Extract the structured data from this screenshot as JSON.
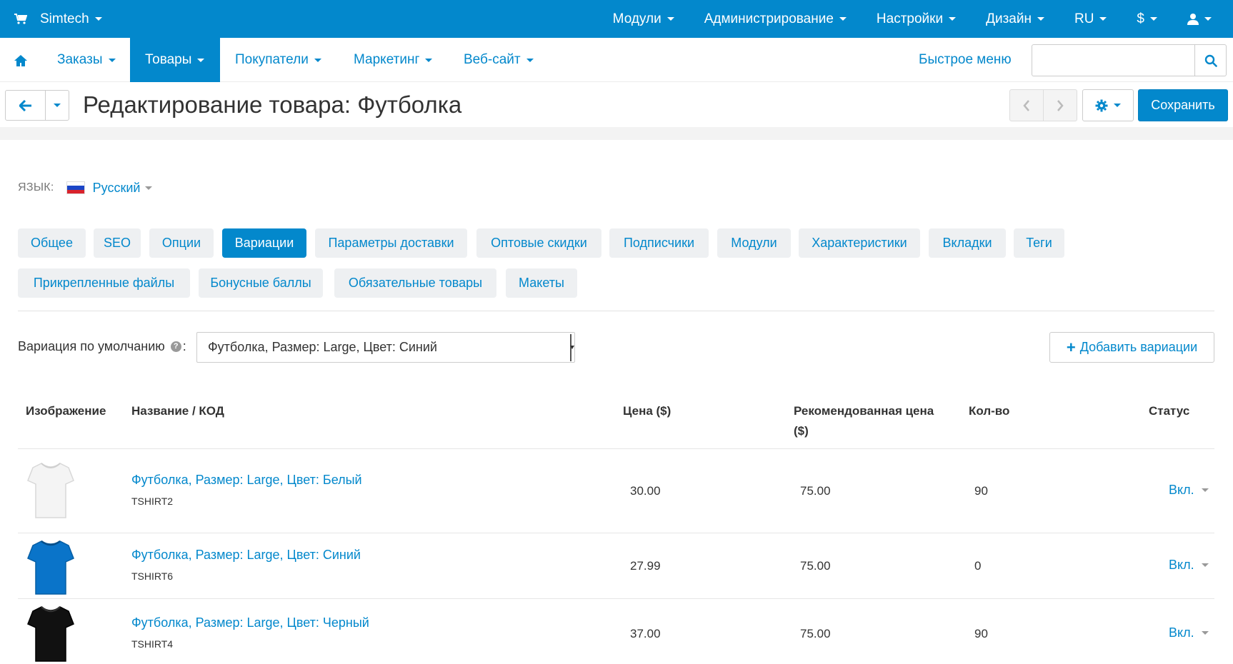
{
  "topbar": {
    "brand": "Simtech",
    "menu": [
      "Модули",
      "Администрирование",
      "Настройки",
      "Дизайн",
      "RU",
      "$"
    ]
  },
  "nav": {
    "tabs": [
      "Заказы",
      "Товары",
      "Покупатели",
      "Маркетинг",
      "Веб-сайт"
    ],
    "active_tab": "Товары",
    "quick_menu": "Быстрое меню",
    "search_placeholder": ""
  },
  "page": {
    "title": "Редактирование товара: Футболка",
    "save_label": "Сохранить"
  },
  "language": {
    "label": "ЯЗЫК:",
    "value": "Русский"
  },
  "section_tabs": {
    "row1": [
      "Общее",
      "SEO",
      "Опции",
      "Вариации",
      "Параметры доставки",
      "Оптовые скидки",
      "Подписчики",
      "Модули",
      "Характеристики",
      "Вкладки",
      "Теги"
    ],
    "row2": [
      "Прикрепленные файлы",
      "Бонусные баллы",
      "Обязательные товары",
      "Макеты"
    ],
    "active": "Вариации"
  },
  "default_variation": {
    "label": "Вариация по умолчанию",
    "help": "?",
    "colon": ":",
    "value": "Футболка, Размер: Large, Цвет: Синий"
  },
  "add_variations_label": "Добавить вариации",
  "table": {
    "headers": {
      "image": "Изображение",
      "name": "Название / КОД",
      "price": "Цена ($)",
      "list_price_1": "Рекомендованная цена",
      "list_price_2": "($)",
      "qty": "Кол-во",
      "status": "Статус"
    },
    "rows": [
      {
        "name": "Футболка, Размер: Large, Цвет: Белый",
        "code": "TSHIRT2",
        "price": "30.00",
        "list_price": "75.00",
        "qty": "90",
        "status": "Вкл.",
        "color": "#f4f4f4"
      },
      {
        "name": "Футболка, Размер: Large, Цвет: Синий",
        "code": "TSHIRT6",
        "price": "27.99",
        "list_price": "75.00",
        "qty": "0",
        "status": "Вкл.",
        "color": "#0a74c9"
      },
      {
        "name": "Футболка, Размер: Large, Цвет: Черный",
        "code": "TSHIRT4",
        "price": "37.00",
        "list_price": "75.00",
        "qty": "90",
        "status": "Вкл.",
        "color": "#111111"
      }
    ]
  },
  "colors": {
    "brand_blue": "#0388cc",
    "tab_gray": "#eef0f2"
  }
}
